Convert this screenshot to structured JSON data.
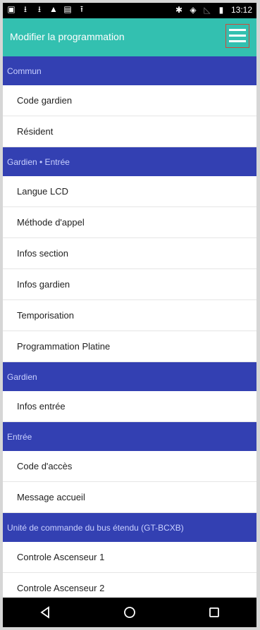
{
  "statusbar": {
    "left_icons": [
      "image-icon",
      "download-icon",
      "download-icon",
      "drive-icon",
      "calendar-icon",
      "upload-icon"
    ],
    "right_icons": [
      "bluetooth-icon",
      "vibrate-icon",
      "no-signal-icon",
      "battery-icon"
    ],
    "time": "13:12"
  },
  "appbar": {
    "title": "Modifier la programmation",
    "menu_icon": "hamburger-menu-icon"
  },
  "colors": {
    "appbar": "#33c0b0",
    "section": "#3340b2",
    "menu_border": "#d04a3a"
  },
  "sections": [
    {
      "title": "Commun",
      "items": [
        "Code gardien",
        "Résident"
      ]
    },
    {
      "title": "Gardien • Entrée",
      "items": [
        "Langue LCD",
        "Méthode d'appel",
        "Infos section",
        "Infos gardien",
        "Temporisation",
        "Programmation Platine"
      ]
    },
    {
      "title": "Gardien",
      "items": [
        "Infos entrée"
      ]
    },
    {
      "title": "Entrée",
      "items": [
        "Code d'accès",
        "Message accueil"
      ]
    },
    {
      "title": "Unité de commande du bus étendu (GT-BCXB)",
      "items": [
        "Controle Ascenseur 1",
        "Controle Ascenseur 2"
      ]
    }
  ],
  "navbar": {
    "icons": [
      "back-icon",
      "home-icon",
      "recents-icon"
    ]
  }
}
